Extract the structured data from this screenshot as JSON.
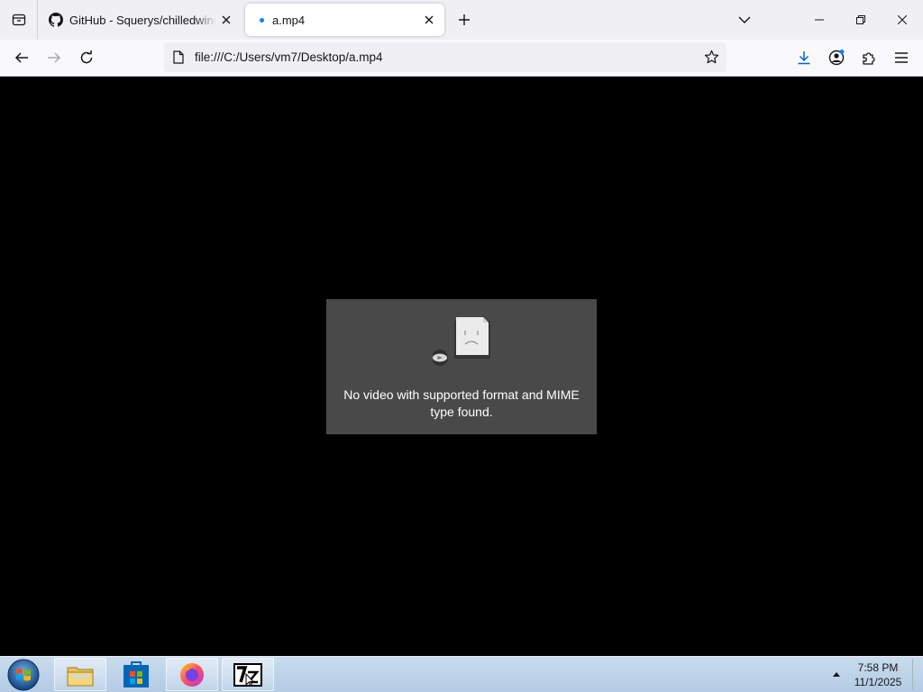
{
  "browser": {
    "tabs": [
      {
        "title": "GitHub - Squerys/chilledwindows",
        "favicon": "github-icon",
        "active": false
      },
      {
        "title": "a.mp4",
        "favicon": "blue-dot",
        "active": true
      }
    ],
    "url": "file:///C:/Users/vm7/Desktop/a.mp4",
    "accent": "#0a84ff"
  },
  "content": {
    "error_message": "No video with supported format and MIME\ntype found.",
    "background": "#000000"
  },
  "taskbar": {
    "pinned": [
      "windows-start-icon",
      "file-explorer-icon",
      "microsoft-store-icon",
      "firefox-icon",
      "7zip-icon"
    ],
    "clock_time": "7:58 PM",
    "clock_date": "11/1/2025"
  }
}
